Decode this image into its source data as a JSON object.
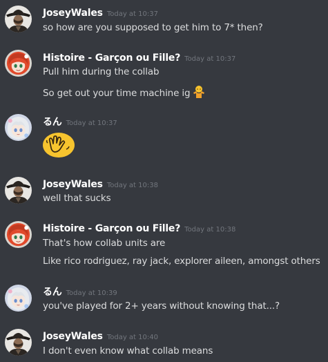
{
  "messages": [
    {
      "author": "JoseyWales",
      "timestamp": "Today at 10:37",
      "avatar_icon": "cowboy-avatar",
      "lines": [
        "so how are  you supposed to get him to 7* then?"
      ]
    },
    {
      "author": "Histoire - Garçon ou Fille?",
      "timestamp": "Today at 10:37",
      "avatar_icon": "red-hair-avatar",
      "lines": [
        "Pull him during the collab",
        "So get out your time machine ig"
      ],
      "line_emoji": "person-shrugging-emoji"
    },
    {
      "author": "るん",
      "timestamp": "Today at 10:37",
      "avatar_icon": "silver-hair-avatar",
      "emoji": "waving-hand-blob-emoji"
    },
    {
      "author": "JoseyWales",
      "timestamp": "Today at 10:38",
      "avatar_icon": "cowboy-avatar",
      "lines": [
        "well that sucks"
      ]
    },
    {
      "author": "Histoire - Garçon ou Fille?",
      "timestamp": "Today at 10:38",
      "avatar_icon": "red-hair-avatar",
      "lines": [
        "That's how collab units are",
        "Like rico rodriguez, ray jack, explorer aileen, amongst others"
      ]
    },
    {
      "author": "るん",
      "timestamp": "Today at 10:39",
      "avatar_icon": "silver-hair-avatar",
      "lines": [
        "you've played for 2+ years without knowing that...?"
      ]
    },
    {
      "author": "JoseyWales",
      "timestamp": "Today at 10:40",
      "avatar_icon": "cowboy-avatar",
      "lines": [
        "I don't even know what collab means"
      ]
    }
  ],
  "colors": {
    "background": "#36393f",
    "username": "#ffffff",
    "timestamp": "#72767d",
    "text": "#dcddde",
    "emoji_yellow": "#f7c42e"
  }
}
